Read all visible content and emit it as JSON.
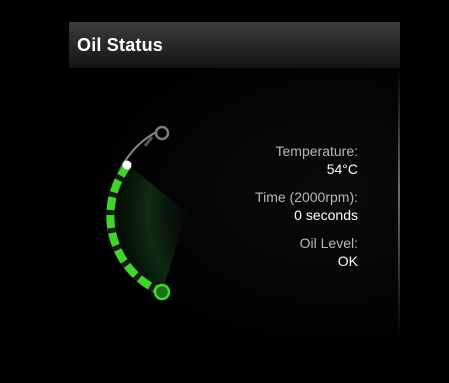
{
  "header": {
    "title": "Oil Status"
  },
  "gauge": {
    "level": 1.0,
    "accent_color": "#3fd52a",
    "indicator_color": "#ffffff"
  },
  "readouts": {
    "temperature": {
      "label": "Temperature:",
      "value": "54°C"
    },
    "time": {
      "label": "Time (2000rpm):",
      "value": "0 seconds"
    },
    "oil_level": {
      "label": "Oil Level:",
      "value": "OK"
    }
  }
}
